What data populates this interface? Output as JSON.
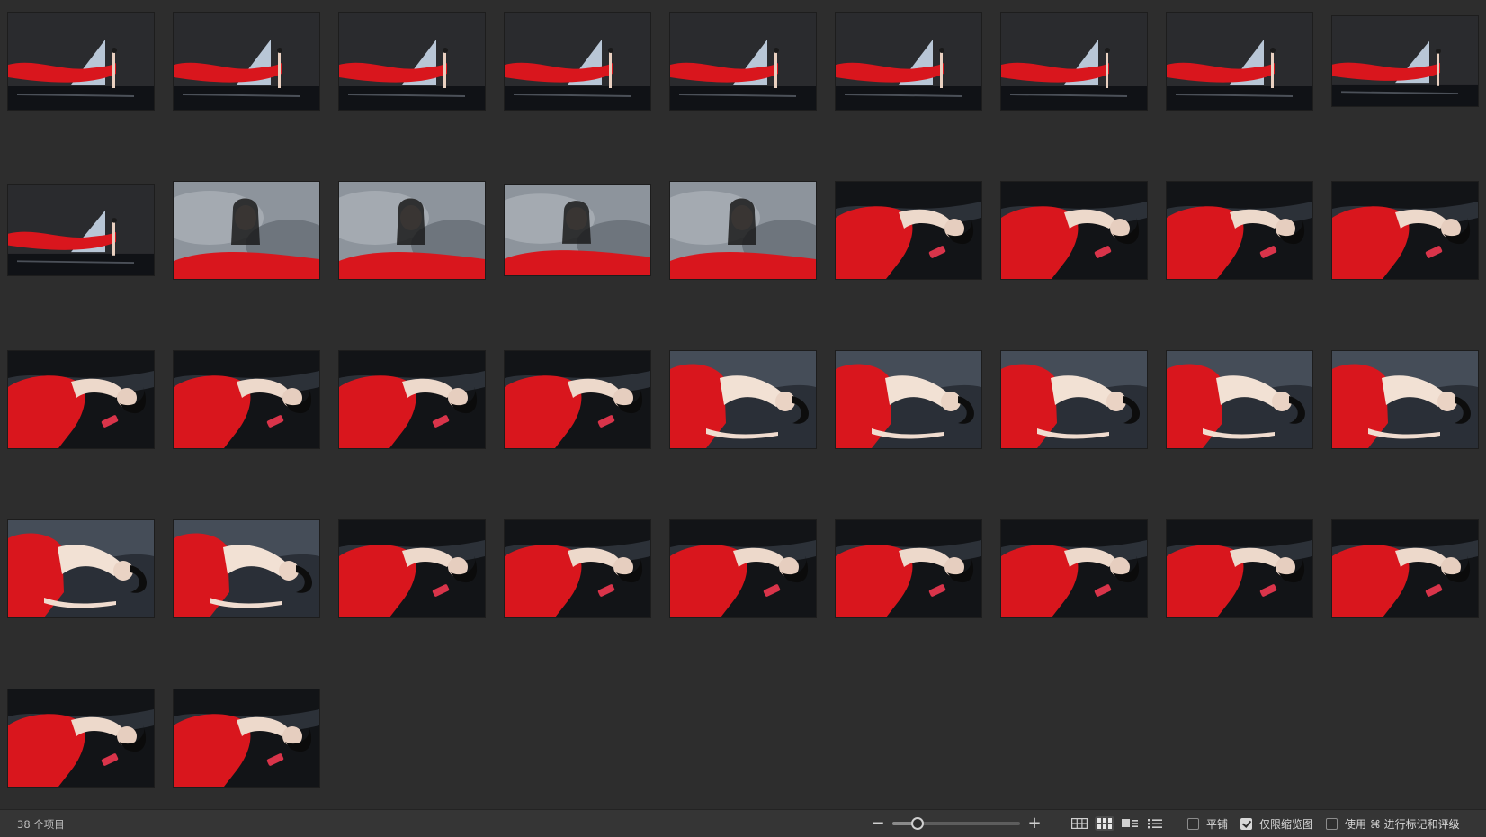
{
  "browser": {
    "item_count_label": "38 个项目",
    "thumbnails": [
      {
        "scene": "dance-scarf-stage",
        "letterbox": "fit"
      },
      {
        "scene": "dance-scarf-stage",
        "letterbox": "fit"
      },
      {
        "scene": "dance-scarf-stage",
        "letterbox": "fit"
      },
      {
        "scene": "dance-scarf-stage",
        "letterbox": "fit"
      },
      {
        "scene": "dance-scarf-stage",
        "letterbox": "fit"
      },
      {
        "scene": "dance-scarf-stage",
        "letterbox": "fit"
      },
      {
        "scene": "dance-scarf-stage",
        "letterbox": "fit"
      },
      {
        "scene": "dance-scarf-stage",
        "letterbox": "fit"
      },
      {
        "scene": "dance-scarf-stage",
        "letterbox": "short"
      },
      {
        "scene": "dance-scarf-stage",
        "letterbox": "short"
      },
      {
        "scene": "portrait-grey-backdrop",
        "letterbox": "fit"
      },
      {
        "scene": "portrait-grey-backdrop",
        "letterbox": "fit"
      },
      {
        "scene": "portrait-grey-backdrop",
        "letterbox": "short"
      },
      {
        "scene": "portrait-grey-backdrop",
        "letterbox": "fit"
      },
      {
        "scene": "reclining-dark-water",
        "letterbox": "fit"
      },
      {
        "scene": "reclining-dark-water",
        "letterbox": "fit"
      },
      {
        "scene": "reclining-dark-water",
        "letterbox": "fit"
      },
      {
        "scene": "reclining-dark-water",
        "letterbox": "fit"
      },
      {
        "scene": "reclining-dark-water",
        "letterbox": "fit"
      },
      {
        "scene": "reclining-dark-water",
        "letterbox": "fit"
      },
      {
        "scene": "reclining-dark-water",
        "letterbox": "fit"
      },
      {
        "scene": "reclining-dark-water",
        "letterbox": "fit"
      },
      {
        "scene": "reclining-light-water",
        "letterbox": "fit"
      },
      {
        "scene": "reclining-light-water",
        "letterbox": "fit"
      },
      {
        "scene": "reclining-light-water",
        "letterbox": "fit"
      },
      {
        "scene": "reclining-light-water",
        "letterbox": "fit"
      },
      {
        "scene": "reclining-light-water",
        "letterbox": "fit"
      },
      {
        "scene": "reclining-light-water",
        "letterbox": "fit"
      },
      {
        "scene": "reclining-light-water",
        "letterbox": "fit"
      },
      {
        "scene": "reclining-dark-water",
        "letterbox": "fit"
      },
      {
        "scene": "reclining-dark-water",
        "letterbox": "fit"
      },
      {
        "scene": "reclining-dark-water",
        "letterbox": "fit"
      },
      {
        "scene": "reclining-dark-water",
        "letterbox": "fit"
      },
      {
        "scene": "reclining-dark-water",
        "letterbox": "fit"
      },
      {
        "scene": "reclining-dark-water",
        "letterbox": "fit"
      },
      {
        "scene": "reclining-dark-water",
        "letterbox": "fit"
      },
      {
        "scene": "reclining-dark-water",
        "letterbox": "fit"
      },
      {
        "scene": "reclining-dark-water",
        "letterbox": "fit"
      }
    ]
  },
  "toolbar": {
    "zoom_out_icon": "minus-icon",
    "zoom_in_icon": "plus-icon",
    "zoom_level_fraction": 0.2,
    "view_modes": [
      {
        "icon": "grid-large-icon",
        "active": false
      },
      {
        "icon": "grid-small-icon",
        "active": true
      },
      {
        "icon": "filmstrip-icon",
        "active": false
      },
      {
        "icon": "list-icon",
        "active": false
      }
    ],
    "options": [
      {
        "label": "平铺",
        "checked": false
      },
      {
        "label": "仅限缩览图",
        "checked": true
      },
      {
        "label": "使用 ⌘ 进行标记和评级",
        "checked": false
      }
    ]
  },
  "colors": {
    "background": "#2d2d2d",
    "accent_red": "#d9161d"
  }
}
